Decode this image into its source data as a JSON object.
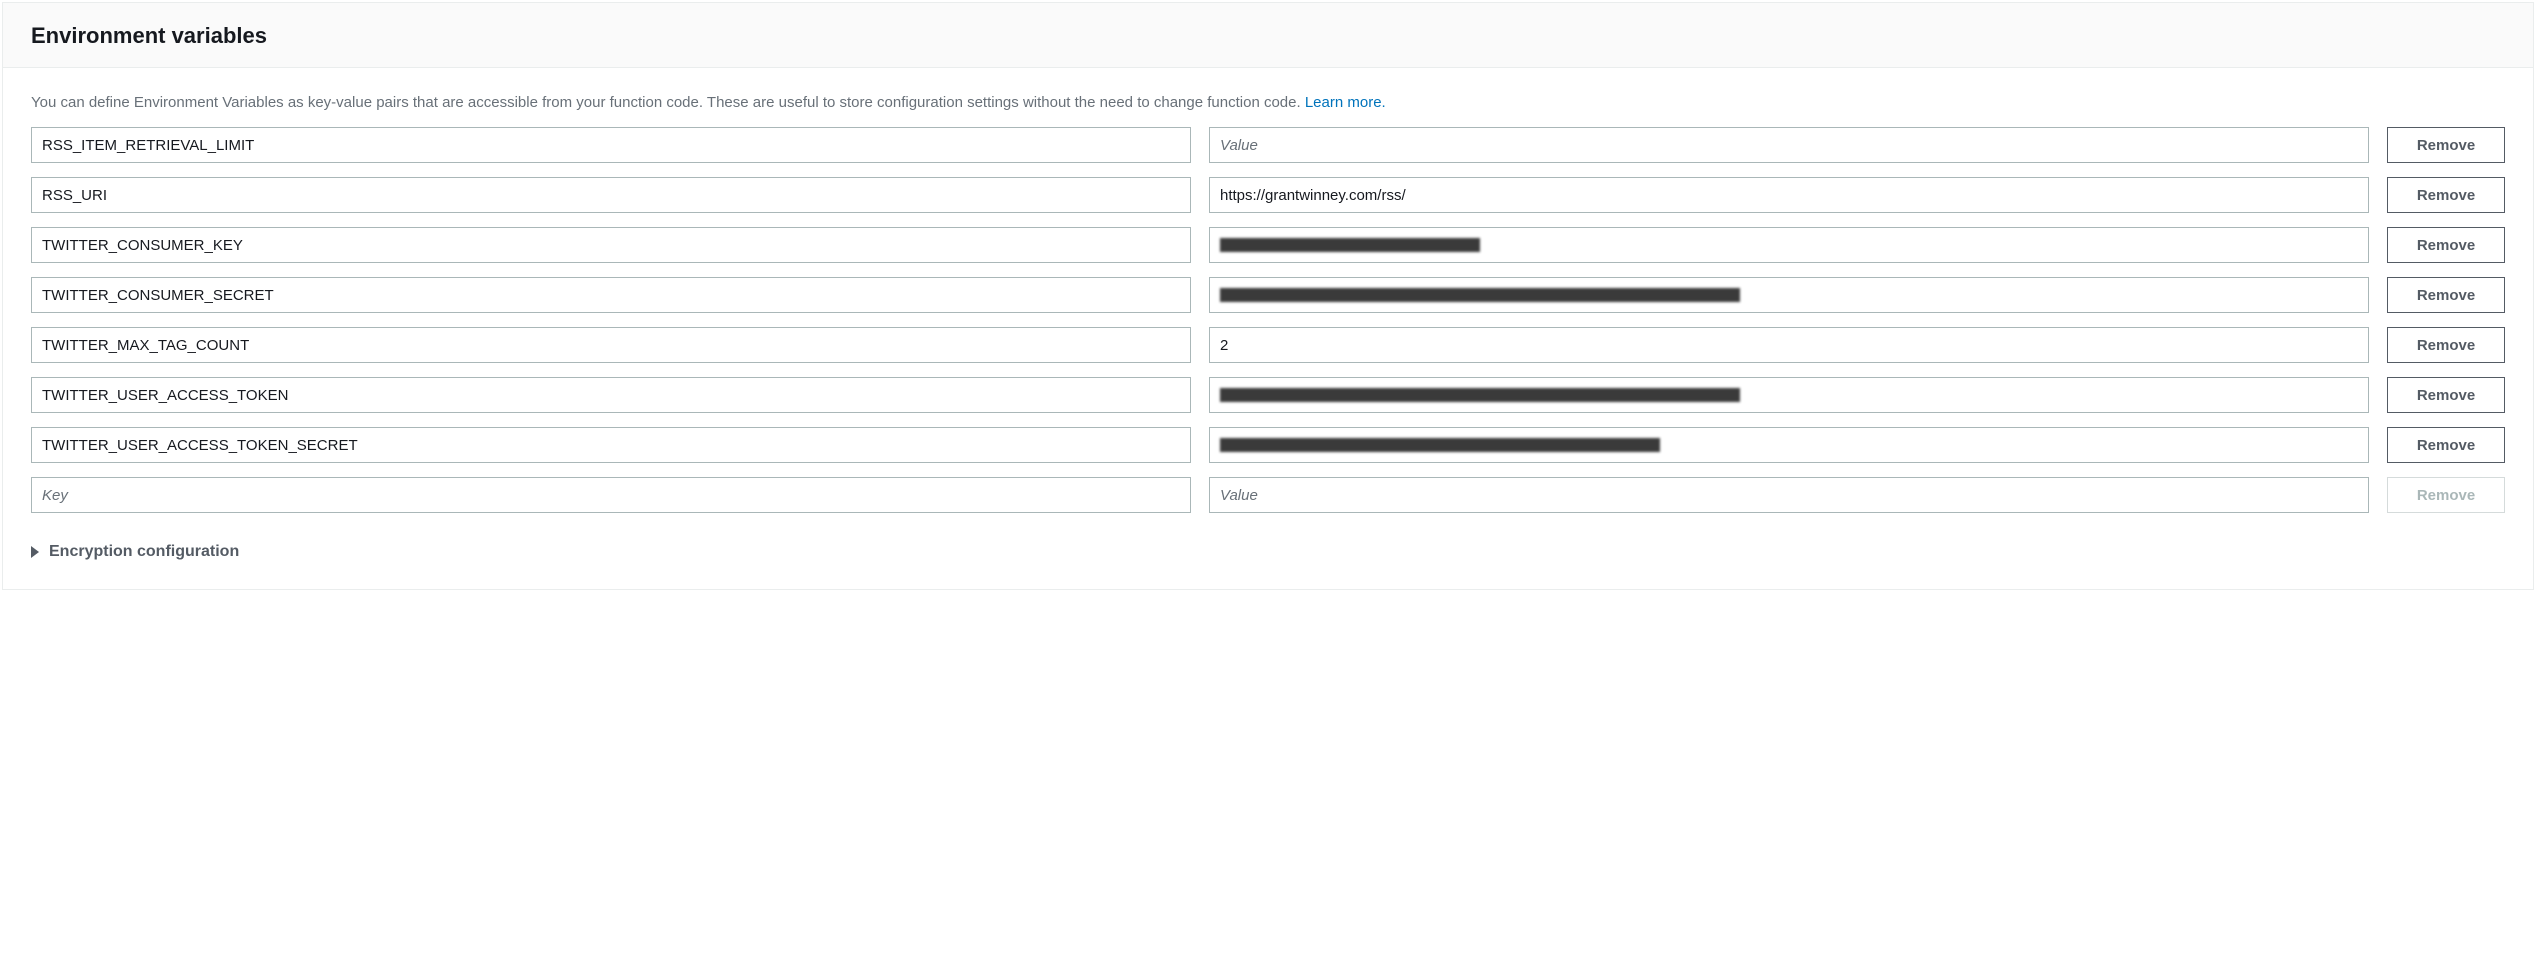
{
  "header": {
    "title": "Environment variables"
  },
  "description": {
    "text": "You can define Environment Variables as key-value pairs that are accessible from your function code. These are useful to store configuration settings without the need to change function code. ",
    "learn_more": "Learn more."
  },
  "placeholders": {
    "key": "Key",
    "value": "Value"
  },
  "buttons": {
    "remove": "Remove"
  },
  "rows": [
    {
      "key": "RSS_ITEM_RETRIEVAL_LIMIT",
      "value": "",
      "value_placeholder": "Value",
      "redacted": false,
      "redacted_width": 0,
      "remove_disabled": false
    },
    {
      "key": "RSS_URI",
      "value": "https://grantwinney.com/rss/",
      "value_placeholder": "",
      "redacted": false,
      "redacted_width": 0,
      "remove_disabled": false
    },
    {
      "key": "TWITTER_CONSUMER_KEY",
      "value": "",
      "value_placeholder": "",
      "redacted": true,
      "redacted_width": 260,
      "remove_disabled": false
    },
    {
      "key": "TWITTER_CONSUMER_SECRET",
      "value": "",
      "value_placeholder": "",
      "redacted": true,
      "redacted_width": 520,
      "remove_disabled": false
    },
    {
      "key": "TWITTER_MAX_TAG_COUNT",
      "value": "2",
      "value_placeholder": "",
      "redacted": false,
      "redacted_width": 0,
      "remove_disabled": false
    },
    {
      "key": "TWITTER_USER_ACCESS_TOKEN",
      "value": "",
      "value_placeholder": "",
      "redacted": true,
      "redacted_width": 520,
      "remove_disabled": false
    },
    {
      "key": "TWITTER_USER_ACCESS_TOKEN_SECRET",
      "value": "",
      "value_placeholder": "",
      "redacted": true,
      "redacted_width": 440,
      "remove_disabled": false
    },
    {
      "key": "",
      "value": "",
      "value_placeholder": "Value",
      "redacted": false,
      "redacted_width": 0,
      "remove_disabled": true
    }
  ],
  "expander": {
    "label": "Encryption configuration"
  }
}
